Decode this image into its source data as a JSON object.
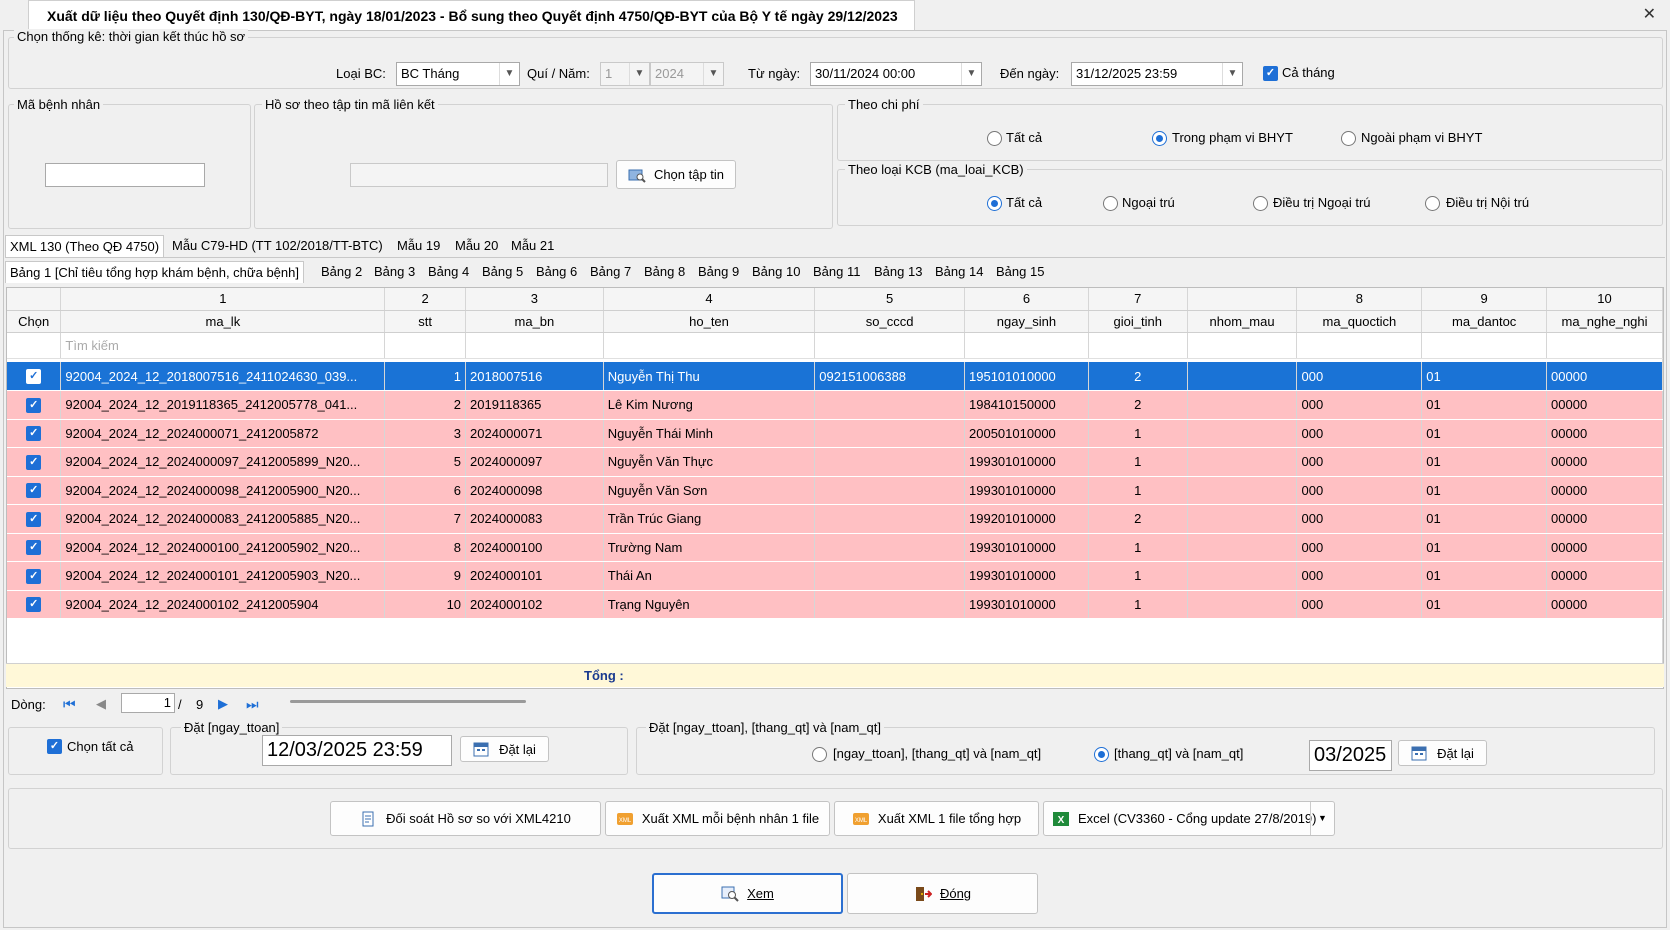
{
  "window": {
    "title": "Xuất dữ liệu theo Quyết định 130/QĐ-BYT, ngày 18/01/2023 - Bổ sung theo Quyết định 4750/QĐ-BYT của Bộ Y tế ngày 29/12/2023",
    "close_label": "✕"
  },
  "filter": {
    "group_label": "Chọn thống kê: thời gian kết thúc hồ sơ",
    "loai_bc_label": "Loại BC:",
    "loai_bc_value": "BC Tháng",
    "qui_nam_label": "Quí / Năm:",
    "qui_value": "1",
    "nam_value": "2024",
    "tu_ngay_label": "Từ ngày:",
    "tu_ngay_value": "30/11/2024 00:00",
    "den_ngay_label": "Đến ngày:",
    "den_ngay_value": "31/12/2025 23:59",
    "ca_thang_label": "Cả tháng"
  },
  "patient": {
    "group_label": "Mã bệnh nhân",
    "value": ""
  },
  "file_group": {
    "label": "Hồ sơ theo tập tin mã liên kết",
    "value": "",
    "button": "Chọn tập tin"
  },
  "chi_phi": {
    "label": "Theo chi phí",
    "options": [
      "Tất cả",
      "Trong phạm vi BHYT",
      "Ngoài phạm vi BHYT"
    ],
    "selected": 1
  },
  "loai_kcb": {
    "label": "Theo loại KCB (ma_loai_KCB)",
    "options": [
      "Tất cả",
      "Ngoại trú",
      "Điều trị Ngoại trú",
      "Điều trị Nội trú"
    ],
    "selected": 0
  },
  "top_tabs": [
    "XML 130 (Theo QĐ 4750)",
    "Mẫu C79-HD (TT 102/2018/TT-BTC)",
    "Mẫu 19",
    "Mẫu 20",
    "Mẫu 21"
  ],
  "sub_tabs": [
    "Bảng 1 [Chỉ tiêu tổng hợp khám bệnh, chữa bệnh]",
    "Bảng 2",
    "Bảng 3",
    "Bảng 4",
    "Bảng 5",
    "Bảng 6",
    "Bảng 7",
    "Bảng 8",
    "Bảng 9",
    "Bảng 10",
    "Bảng 11",
    "Bảng 13",
    "Bảng 14",
    "Bảng 15"
  ],
  "grid": {
    "col_numbers": [
      "",
      "1",
      "2",
      "3",
      "4",
      "5",
      "6",
      "7",
      "",
      "8",
      "9",
      "10"
    ],
    "col_names": [
      "Chọn",
      "ma_lk",
      "stt",
      "ma_bn",
      "ho_ten",
      "so_cccd",
      "ngay_sinh",
      "gioi_tinh",
      "nhom_mau",
      "ma_quoctich",
      "ma_dantoc",
      "ma_nghe_nghi"
    ],
    "search_placeholder": "Tìm kiếm",
    "rows": [
      {
        "ma_lk": "92004_2024_12_2018007516_2411024630_039...",
        "stt": "1",
        "ma_bn": "2018007516",
        "ho_ten": "Nguyễn Thị Thu",
        "so_cccd": "092151006388",
        "ngay_sinh": "195101010000",
        "gioi_tinh": "2",
        "nhom_mau": "",
        "ma_quoctich": "000",
        "ma_dantoc": "01",
        "ma_nghe": "00000"
      },
      {
        "ma_lk": "92004_2024_12_2019118365_2412005778_041...",
        "stt": "2",
        "ma_bn": "2019118365",
        "ho_ten": "Lê Kim Nương",
        "so_cccd": "",
        "ngay_sinh": "198410150000",
        "gioi_tinh": "2",
        "nhom_mau": "",
        "ma_quoctich": "000",
        "ma_dantoc": "01",
        "ma_nghe": "00000"
      },
      {
        "ma_lk": "92004_2024_12_2024000071_2412005872",
        "stt": "3",
        "ma_bn": "2024000071",
        "ho_ten": "Nguyễn Thái Minh",
        "so_cccd": "",
        "ngay_sinh": "200501010000",
        "gioi_tinh": "1",
        "nhom_mau": "",
        "ma_quoctich": "000",
        "ma_dantoc": "01",
        "ma_nghe": "00000"
      },
      {
        "ma_lk": "92004_2024_12_2024000097_2412005899_N20...",
        "stt": "5",
        "ma_bn": "2024000097",
        "ho_ten": "Nguyễn Văn Thực",
        "so_cccd": "",
        "ngay_sinh": "199301010000",
        "gioi_tinh": "1",
        "nhom_mau": "",
        "ma_quoctich": "000",
        "ma_dantoc": "01",
        "ma_nghe": "00000"
      },
      {
        "ma_lk": "92004_2024_12_2024000098_2412005900_N20...",
        "stt": "6",
        "ma_bn": "2024000098",
        "ho_ten": "Nguyễn Văn Sơn",
        "so_cccd": "",
        "ngay_sinh": "199301010000",
        "gioi_tinh": "1",
        "nhom_mau": "",
        "ma_quoctich": "000",
        "ma_dantoc": "01",
        "ma_nghe": "00000"
      },
      {
        "ma_lk": "92004_2024_12_2024000083_2412005885_N20...",
        "stt": "7",
        "ma_bn": "2024000083",
        "ho_ten": "Trần Trúc Giang",
        "so_cccd": "",
        "ngay_sinh": "199201010000",
        "gioi_tinh": "2",
        "nhom_mau": "",
        "ma_quoctich": "000",
        "ma_dantoc": "01",
        "ma_nghe": "00000"
      },
      {
        "ma_lk": "92004_2024_12_2024000100_2412005902_N20...",
        "stt": "8",
        "ma_bn": "2024000100",
        "ho_ten": "Trường Nam",
        "so_cccd": "",
        "ngay_sinh": "199301010000",
        "gioi_tinh": "1",
        "nhom_mau": "",
        "ma_quoctich": "000",
        "ma_dantoc": "01",
        "ma_nghe": "00000"
      },
      {
        "ma_lk": "92004_2024_12_2024000101_2412005903_N20...",
        "stt": "9",
        "ma_bn": "2024000101",
        "ho_ten": "Thái An",
        "so_cccd": "",
        "ngay_sinh": "199301010000",
        "gioi_tinh": "1",
        "nhom_mau": "",
        "ma_quoctich": "000",
        "ma_dantoc": "01",
        "ma_nghe": "00000"
      },
      {
        "ma_lk": "92004_2024_12_2024000102_2412005904",
        "stt": "10",
        "ma_bn": "2024000102",
        "ho_ten": "Trạng Nguyên",
        "so_cccd": "",
        "ngay_sinh": "199301010000",
        "gioi_tinh": "1",
        "nhom_mau": "",
        "ma_quoctich": "000",
        "ma_dantoc": "01",
        "ma_nghe": "00000"
      }
    ],
    "total_label": "Tổng :"
  },
  "pager": {
    "label": "Dòng:",
    "current": "1",
    "separator": "/",
    "total": "9"
  },
  "bottom": {
    "chon_tat_ca": "Chọn tất cả",
    "dat_ngay_ttoan_label": "Đặt [ngay_ttoan]",
    "ngay_ttoan_value": "12/03/2025 23:59",
    "dat_lai": "Đặt lại",
    "dat_group_label": "Đặt  [ngay_ttoan], [thang_qt] và [nam_qt]",
    "radio1": "[ngay_ttoan], [thang_qt] và [nam_qt]",
    "radio2": "[thang_qt] và [nam_qt]",
    "thang_nam_value": "03/2025"
  },
  "actions": {
    "doi_soat": "Đối soát Hồ sơ so với XML4210",
    "xuat_moi": "Xuất XML mỗi bệnh nhân 1 file",
    "xuat_tong": "Xuất XML  1 file tổng hợp",
    "excel": "Excel (CV3360 - Cổng update 27/8/2019)",
    "xem": "Xem",
    "dong": "Đóng"
  },
  "colors": {
    "accent": "#1e6fd6",
    "row_highlight": "#ffc0c3",
    "selected_row": "#1a73d6",
    "total_bar": "#fff8d8"
  }
}
